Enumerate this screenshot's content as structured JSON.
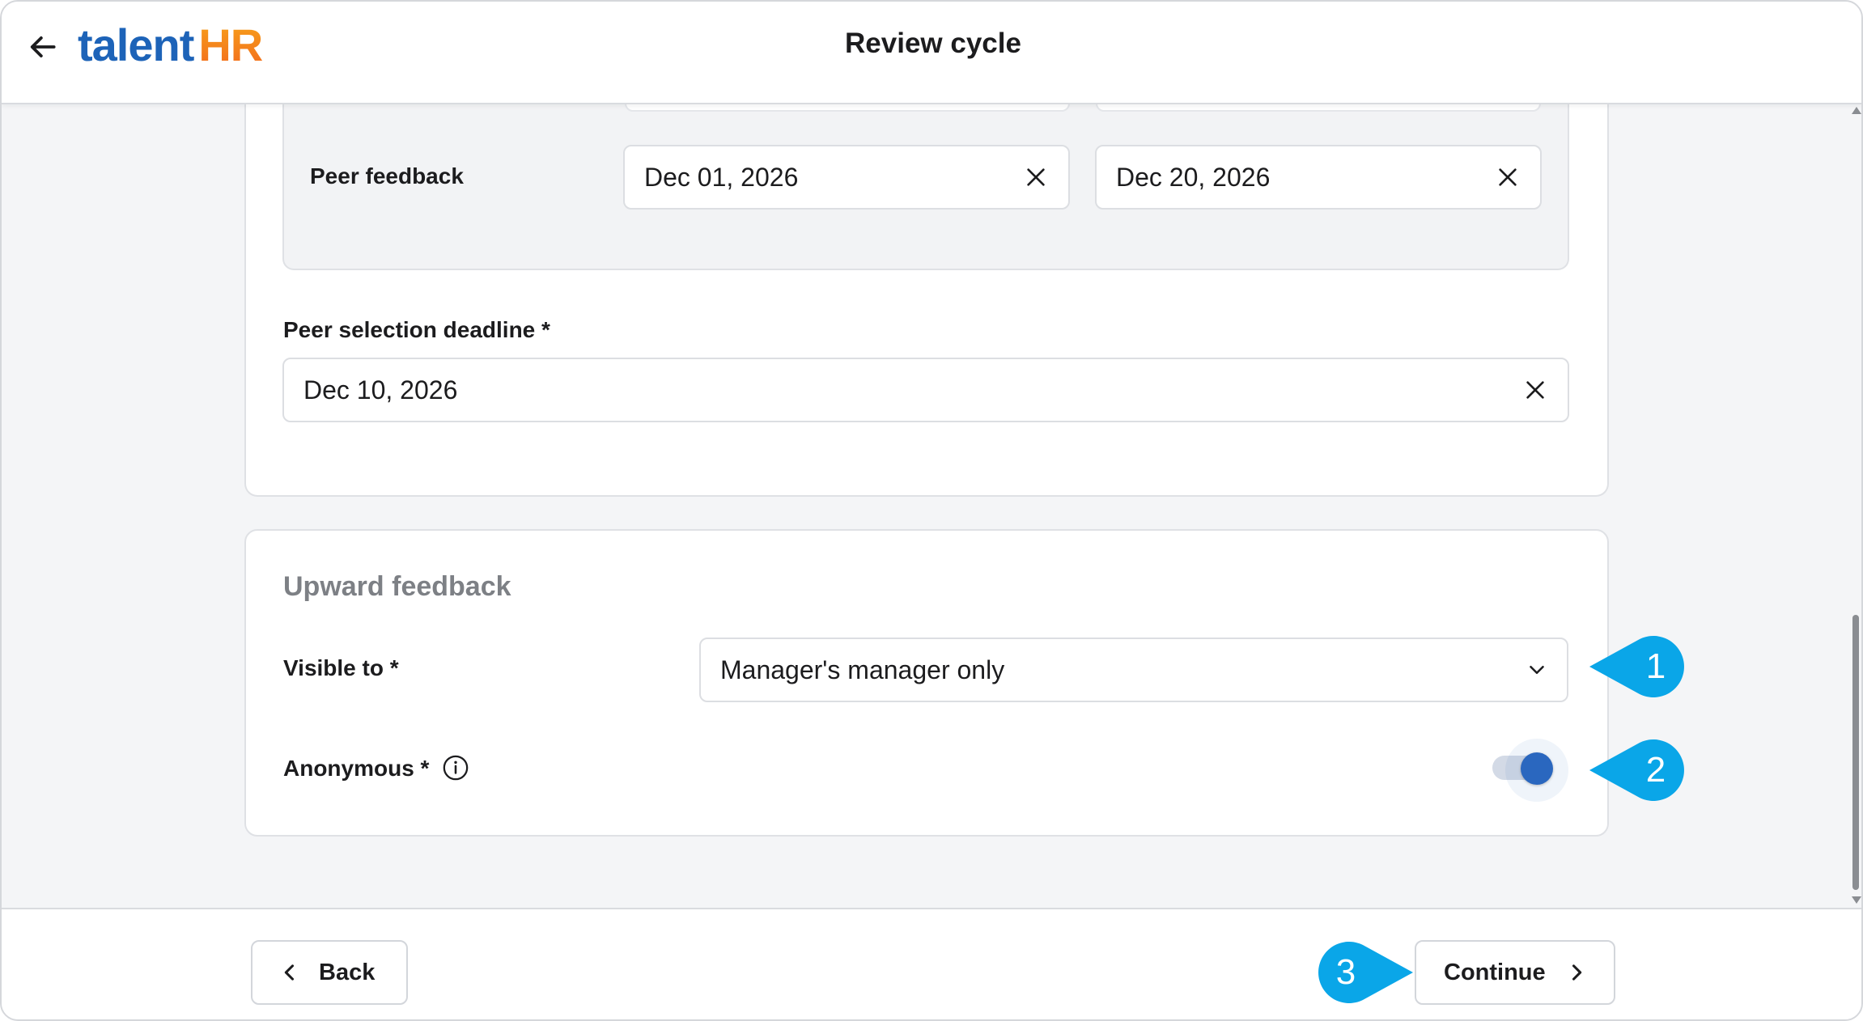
{
  "header": {
    "title": "Review cycle",
    "logo_part1": "talent",
    "logo_part2": "HR"
  },
  "peer_feedback": {
    "label": "Peer feedback",
    "start_date": "Dec 01, 2026",
    "end_date": "Dec 20, 2026"
  },
  "peer_selection_deadline": {
    "label": "Peer selection deadline *",
    "value": "Dec 10, 2026"
  },
  "upward_feedback": {
    "title": "Upward feedback",
    "visible_to_label": "Visible to *",
    "visible_to_value": "Manager's manager only",
    "anonymous_label": "Anonymous *",
    "anonymous_on": true
  },
  "footer": {
    "back_label": "Back",
    "continue_label": "Continue"
  },
  "callouts": [
    "1",
    "2",
    "3"
  ],
  "colors": {
    "brand_blue": "#1d63b8",
    "brand_orange": "#f5841f",
    "callout_blue": "#0aa6e8",
    "toggle_on": "#2a67bf"
  }
}
